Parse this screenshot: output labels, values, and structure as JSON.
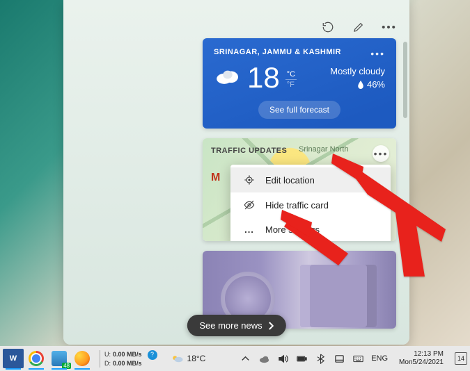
{
  "weather": {
    "location": "SRINAGAR, JAMMU & KASHMIR",
    "temp": "18",
    "unit_c": "°C",
    "unit_f": "°F",
    "condition": "Mostly cloudy",
    "humidity": "46%",
    "forecast_btn": "See full forecast"
  },
  "traffic": {
    "title": "TRAFFIC UPDATES",
    "city_label": "Srinagar North",
    "sub_letter": "M",
    "menu": {
      "edit_location": "Edit location",
      "hide_card": "Hide traffic card",
      "more_settings": "More settings"
    }
  },
  "see_more": "See more news",
  "taskbar": {
    "word_letter": "W",
    "chrome_badge": "48",
    "net_u": "U:",
    "net_d": "D:",
    "speed_u": "0.00 MB/s",
    "speed_d": "0.00 MB/s",
    "temp": "18°C",
    "lang": "ENG",
    "time": "12:13 PM",
    "date": "Mon5/24/2021",
    "notif_count": "14"
  }
}
